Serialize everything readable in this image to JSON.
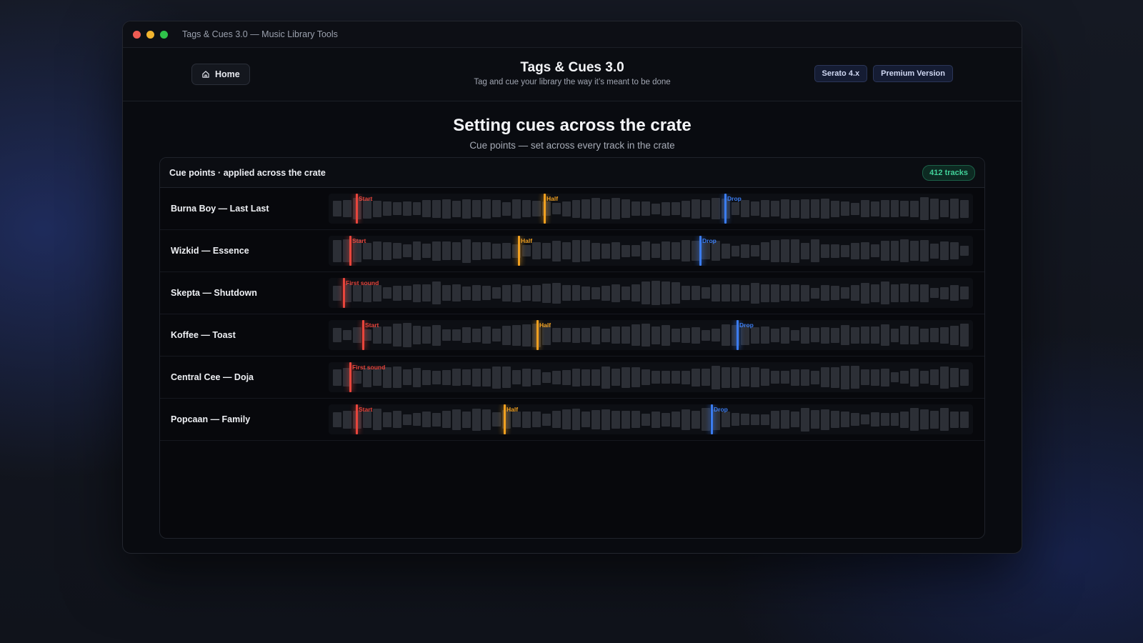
{
  "window": {
    "title": "Tags & Cues 3.0 — Music Library Tools"
  },
  "header": {
    "home_label": "Home",
    "app_title": "Tags & Cues 3.0",
    "tagline": "Tag and cue your library the way it’s meant to be done",
    "badges": [
      "Serato 4.x",
      "Premium Version"
    ]
  },
  "section": {
    "title": "Setting cues across the crate",
    "subtitle": "Cue points — set across every track in the crate"
  },
  "panel": {
    "title": "Cue points · applied across the crate",
    "count": "412 tracks"
  },
  "colors": {
    "start": "#e8453c",
    "half": "#f0a020",
    "drop": "#3b7cf0"
  },
  "tracks": [
    {
      "name": "Burna Boy — Last Last",
      "cues": [
        {
          "label": "Start",
          "type": "start",
          "pos": 0.042
        },
        {
          "label": "Half",
          "type": "half",
          "pos": 0.334
        },
        {
          "label": "Drop",
          "type": "drop",
          "pos": 0.614
        }
      ]
    },
    {
      "name": "Wizkid — Essence",
      "cues": [
        {
          "label": "Start",
          "type": "start",
          "pos": 0.032
        },
        {
          "label": "Half",
          "type": "half",
          "pos": 0.294
        },
        {
          "label": "Drop",
          "type": "drop",
          "pos": 0.575
        }
      ]
    },
    {
      "name": "Skepta — Shutdown",
      "cues": [
        {
          "label": "First sound",
          "type": "start",
          "pos": 0.022
        }
      ]
    },
    {
      "name": "Koffee — Toast",
      "cues": [
        {
          "label": "Start",
          "type": "start",
          "pos": 0.052
        },
        {
          "label": "Half",
          "type": "half",
          "pos": 0.323
        },
        {
          "label": "Drop",
          "type": "drop",
          "pos": 0.633
        }
      ]
    },
    {
      "name": "Central Cee — Doja",
      "cues": [
        {
          "label": "First sound",
          "type": "start",
          "pos": 0.032
        }
      ]
    },
    {
      "name": "Popcaan — Family",
      "cues": [
        {
          "label": "Start",
          "type": "start",
          "pos": 0.042
        },
        {
          "label": "Half",
          "type": "half",
          "pos": 0.272
        },
        {
          "label": "Drop",
          "type": "drop",
          "pos": 0.593
        }
      ]
    }
  ]
}
